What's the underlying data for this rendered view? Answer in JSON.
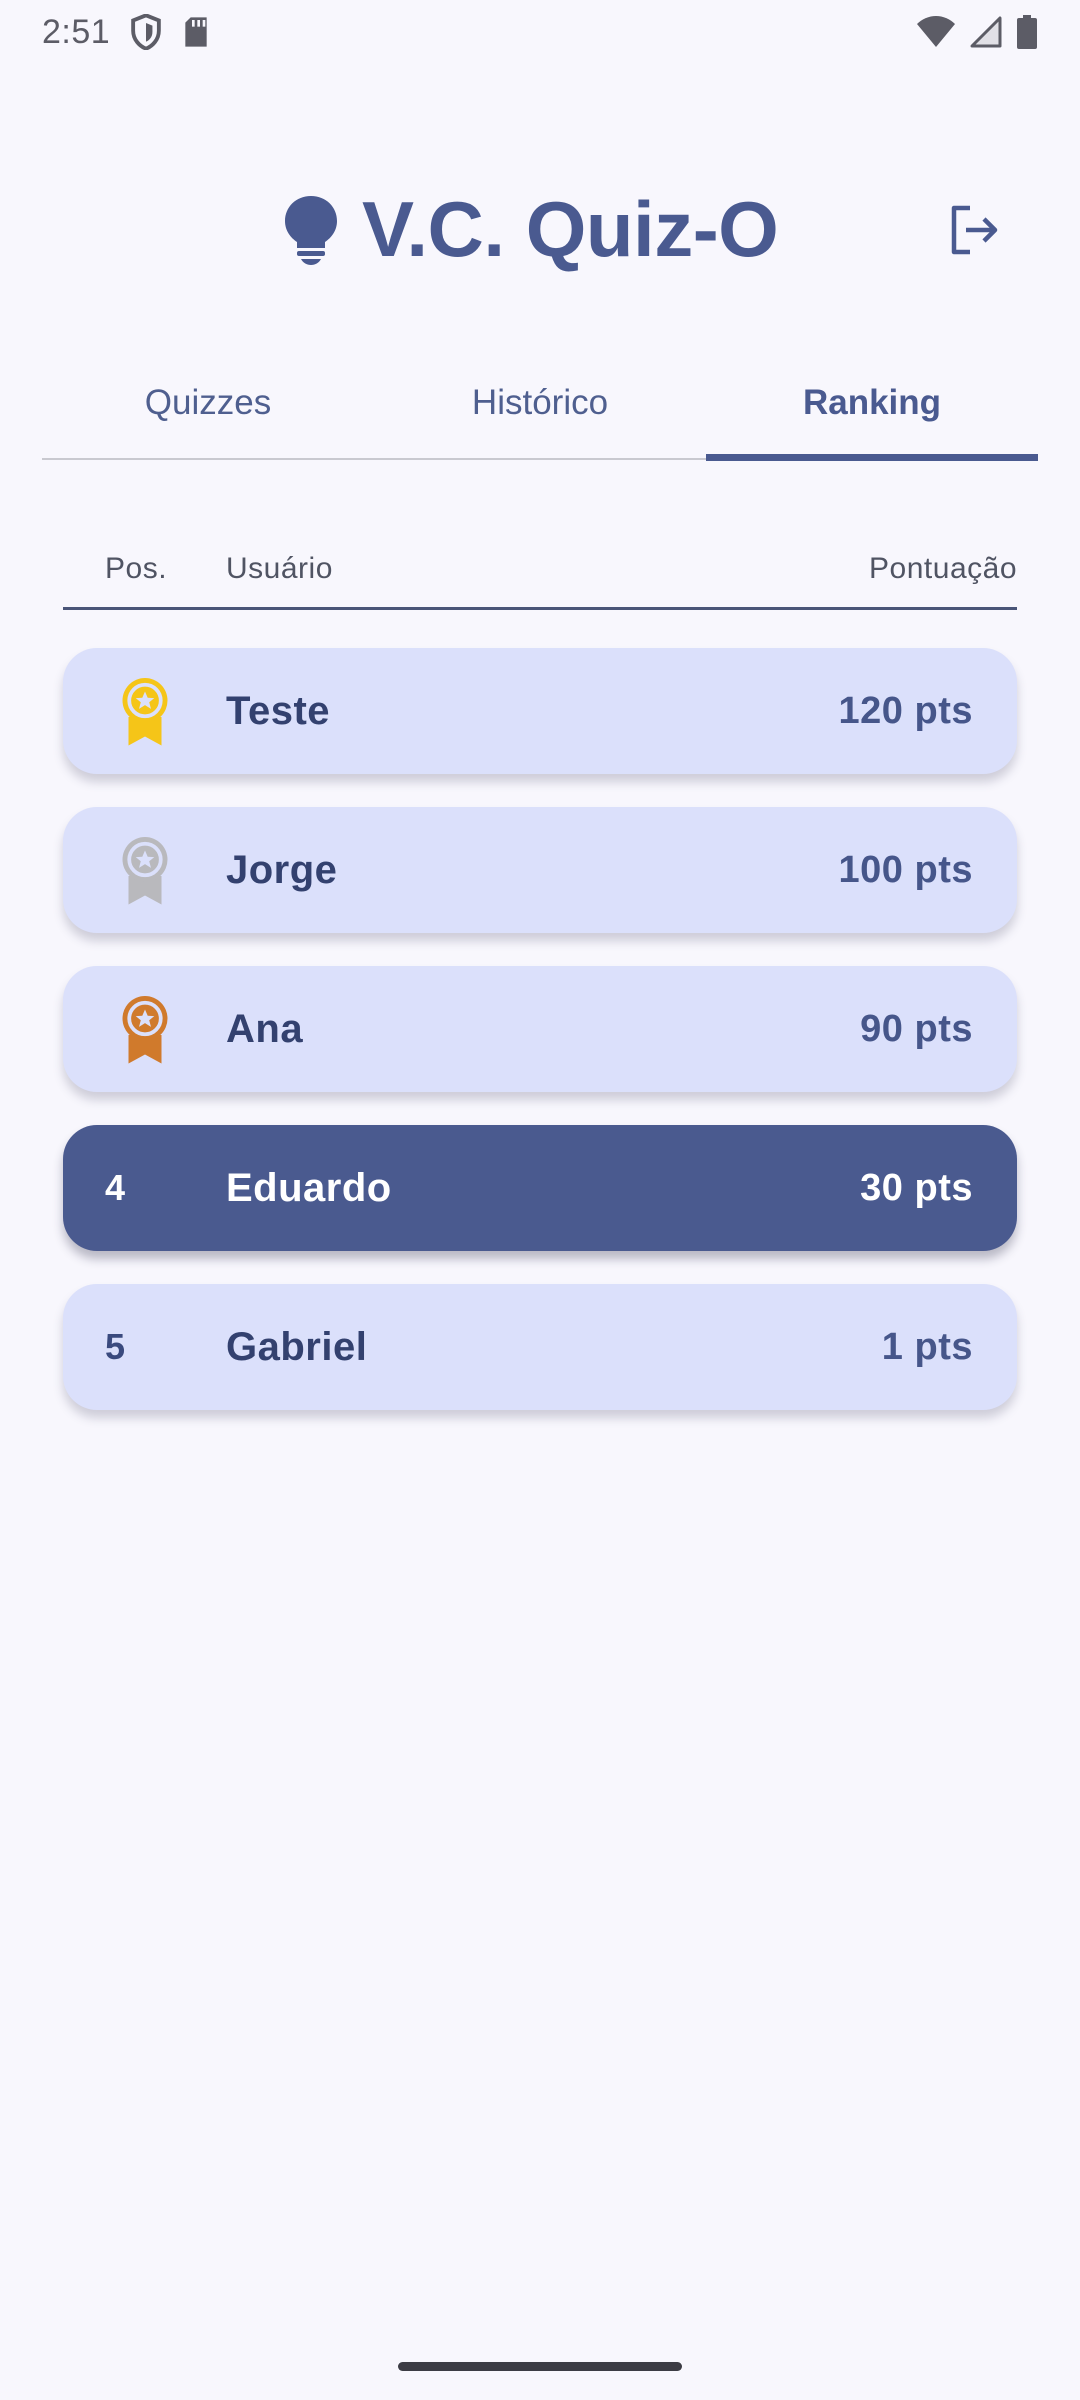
{
  "status_bar": {
    "time": "2:51",
    "left_icons": [
      "shield-icon",
      "sd-card-icon"
    ],
    "right_icons": [
      "wifi-icon",
      "cell-signal-icon",
      "battery-icon"
    ]
  },
  "header": {
    "app_title": "V.C. Quiz-O",
    "logo_icon": "lightbulb-icon",
    "logout_icon": "logout-icon"
  },
  "tabs": [
    {
      "label": "Quizzes",
      "active": false
    },
    {
      "label": "Histórico",
      "active": false
    },
    {
      "label": "Ranking",
      "active": true
    }
  ],
  "ranking": {
    "columns": {
      "position": "Pos.",
      "user": "Usuário",
      "score": "Pontuação"
    },
    "rows": [
      {
        "position": "1",
        "medal": "gold-medal-icon",
        "name": "Teste",
        "score": "120 pts",
        "current_user": false
      },
      {
        "position": "2",
        "medal": "silver-medal-icon",
        "name": "Jorge",
        "score": "100 pts",
        "current_user": false
      },
      {
        "position": "3",
        "medal": "bronze-medal-icon",
        "name": "Ana",
        "score": "90 pts",
        "current_user": false
      },
      {
        "position": "4",
        "medal": null,
        "name": "Eduardo",
        "score": "30 pts",
        "current_user": true
      },
      {
        "position": "5",
        "medal": null,
        "name": "Gabriel",
        "score": "1 pts",
        "current_user": false
      }
    ]
  },
  "colors": {
    "primary": "#4a5a8f",
    "row_background": "#dbe0fb",
    "page_background": "#f8f7fd",
    "gold": "#f5c518",
    "silver": "#b9b9bd",
    "bronze": "#d07a2c"
  }
}
